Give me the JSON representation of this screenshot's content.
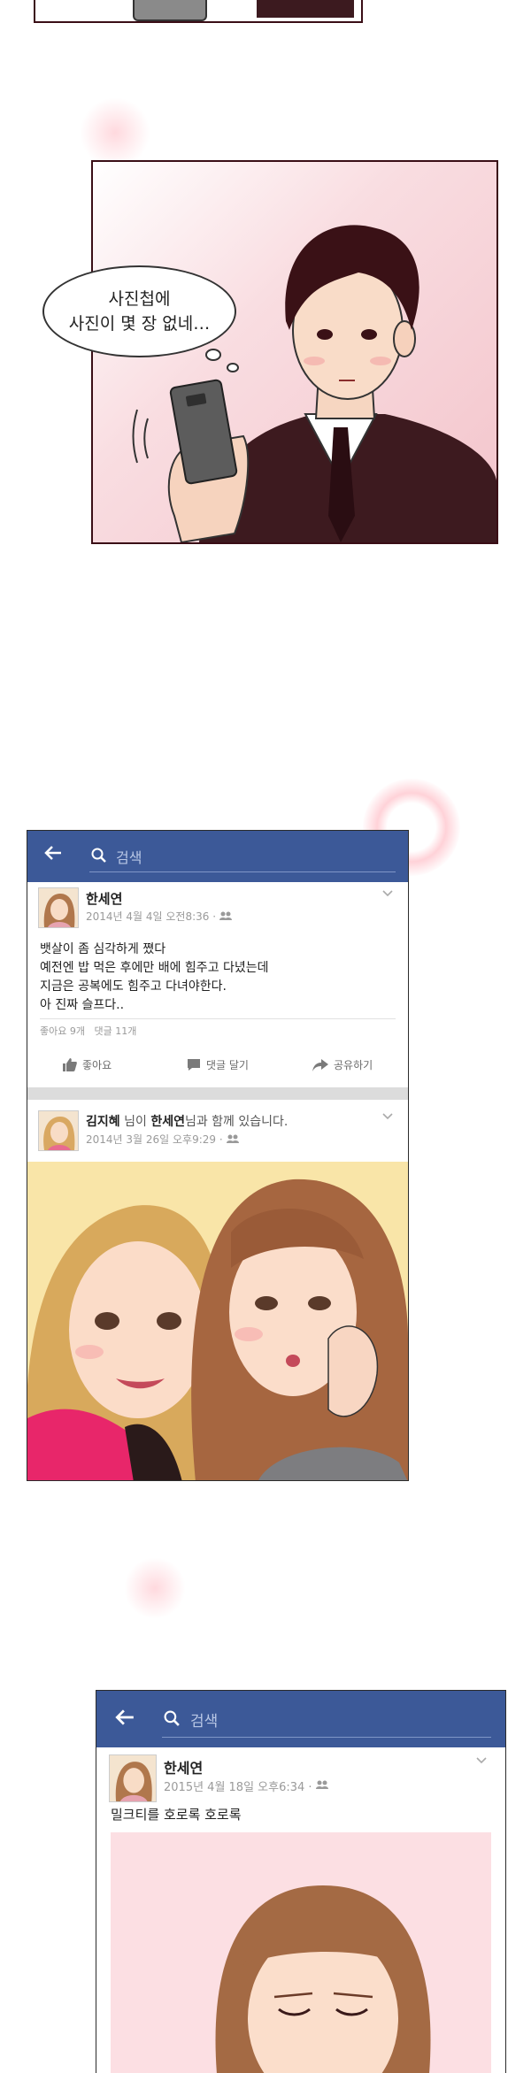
{
  "panel1": {
    "bubble_line1": "사진첩에",
    "bubble_line2": "사진이 몇 장 없네…"
  },
  "feed1": {
    "search_placeholder": "검색",
    "post1": {
      "author": "한세연",
      "timestamp": "2014년 4월 4일 오전8:36 ·",
      "lines": [
        "뱃살이 좀 심각하게 쪘다",
        "예전엔 밥 먹은 후에만 배에 힘주고 다녔는데",
        "지금은 공복에도 힘주고 다녀야한다.",
        "아 진짜 슬프다.."
      ],
      "stats": "좋아요 9개   댓글 11개",
      "like_label": "좋아요",
      "comment_label": "댓글 달기",
      "share_label": "공유하기"
    },
    "post2": {
      "author": "김지혜",
      "with_text_1": " 님이 ",
      "tagged": "한세연",
      "with_text_2": "님과 함께 있습니다.",
      "timestamp": "2014년 3월 26일 오후9:29 ·"
    }
  },
  "feed2": {
    "search_placeholder": "검색",
    "post": {
      "author": "한세연",
      "timestamp": "2015년 4월 18일 오후6:34 ·",
      "text": "밀크티를 호로록 호로록"
    }
  },
  "icons": [
    "back-arrow-icon",
    "search-icon",
    "friends-icon",
    "chevron-down-icon",
    "thumbs-up-icon",
    "comment-icon",
    "share-icon"
  ],
  "colors": {
    "fb_blue": "#3c5998",
    "panel_pink": "#f6cdd3",
    "panel_border": "#3a0e16"
  }
}
